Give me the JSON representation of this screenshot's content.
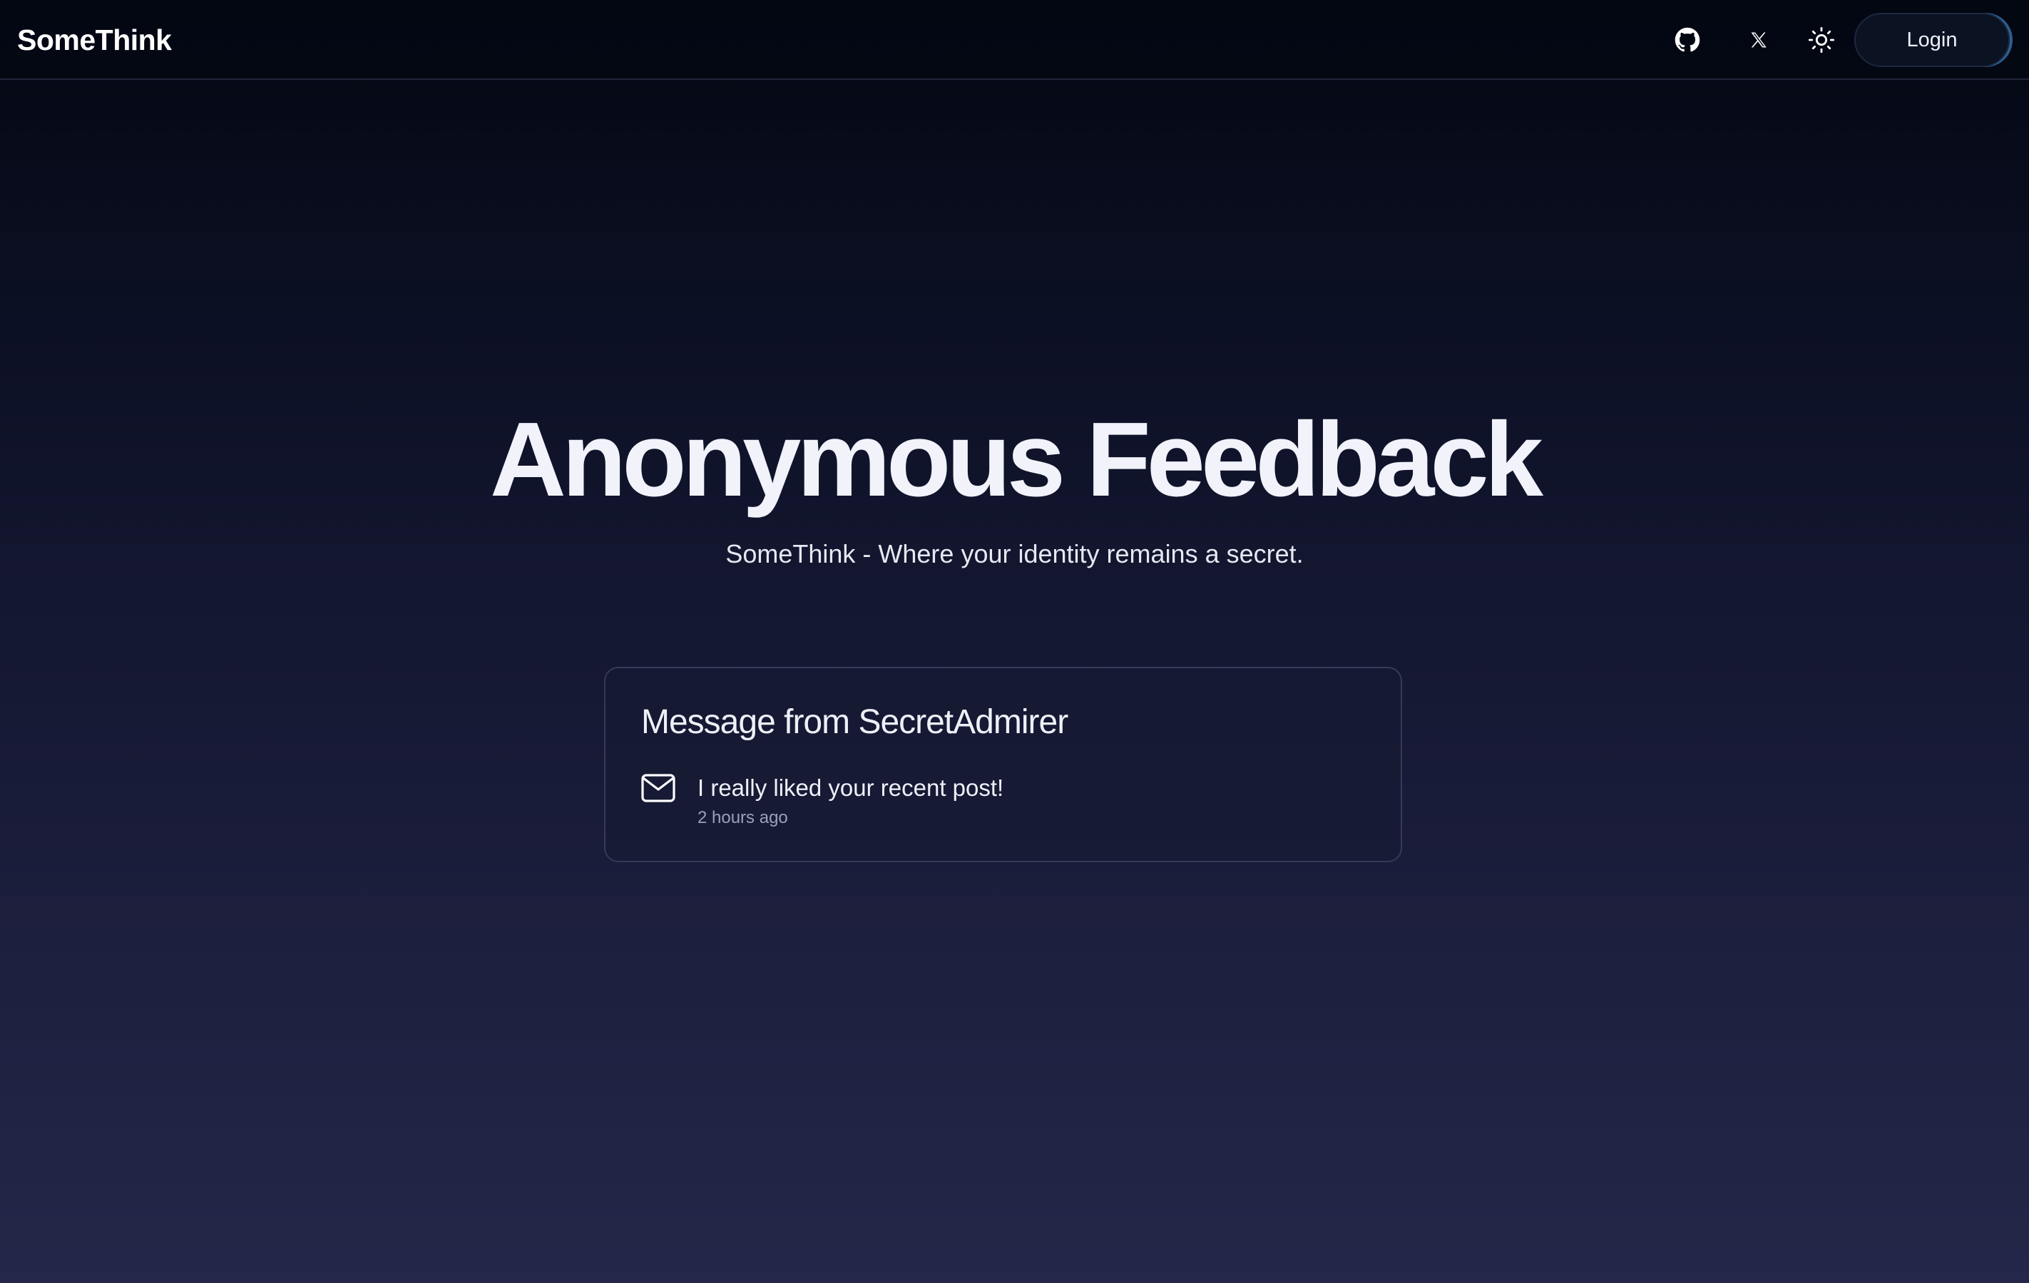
{
  "navbar": {
    "brand": "SomeThink",
    "icons": {
      "github": "github-icon",
      "x": "x-icon",
      "theme": "sun-icon"
    },
    "login_label": "Login"
  },
  "hero": {
    "title": "Anonymous Feedback",
    "subtitle": "SomeThink - Where your identity remains a secret."
  },
  "message_card": {
    "title": "Message from SecretAdmirer",
    "icon": "mail-icon",
    "message": "I really liked your recent post!",
    "time": "2 hours ago"
  },
  "colors": {
    "background_top": "#030712",
    "background_bottom": "#25274a",
    "text": "#eef0f8",
    "muted_text": "#9aa0b8",
    "card_border": "#353a56",
    "login_accent": "#2b5f8f"
  }
}
